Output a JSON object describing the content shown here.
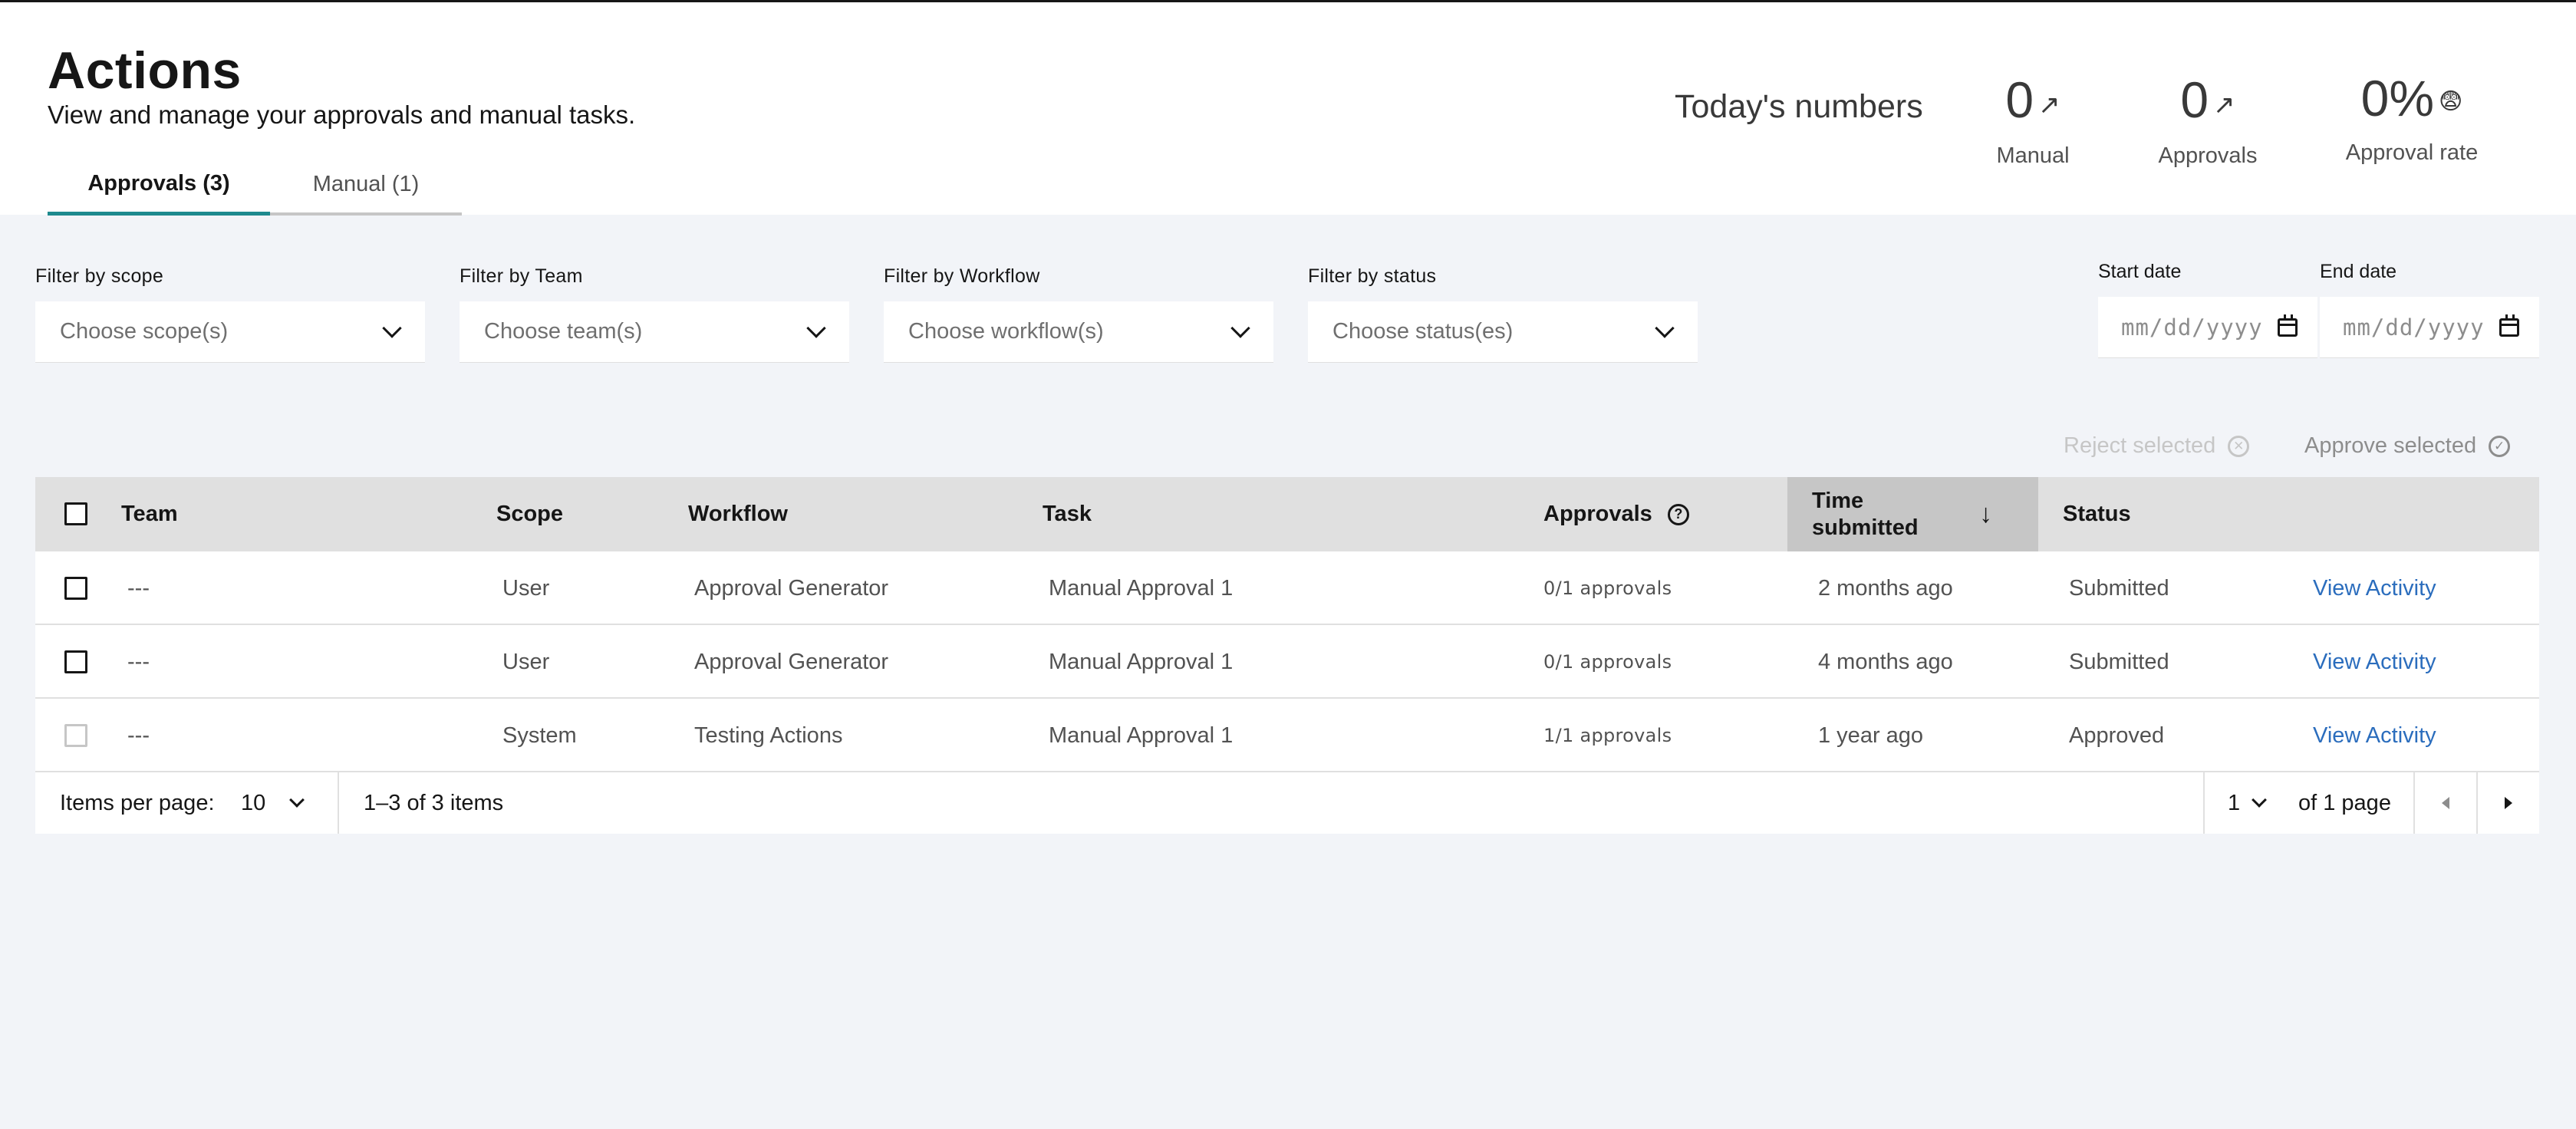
{
  "page": {
    "title": "Actions",
    "subtitle": "View and manage your approvals and manual tasks."
  },
  "tabs": [
    {
      "label": "Approvals (3)",
      "active": true
    },
    {
      "label": "Manual (1)",
      "active": false
    }
  ],
  "stats": {
    "label": "Today's numbers",
    "manual": {
      "value": "0",
      "arrow": "↗",
      "label": "Manual"
    },
    "approvals": {
      "value": "0",
      "arrow": "↗",
      "label": "Approvals"
    },
    "approval_rate": {
      "value": "0%",
      "emoji": "😨",
      "label": "Approval rate"
    }
  },
  "filters": {
    "scope": {
      "label": "Filter by scope",
      "placeholder": "Choose scope(s)"
    },
    "team": {
      "label": "Filter by Team",
      "placeholder": "Choose team(s)"
    },
    "workflow": {
      "label": "Filter by Workflow",
      "placeholder": "Choose workflow(s)"
    },
    "status": {
      "label": "Filter by status",
      "placeholder": "Choose status(es)"
    },
    "start_date": {
      "label": "Start date",
      "placeholder": "mm/dd/yyyy"
    },
    "end_date": {
      "label": "End date",
      "placeholder": "mm/dd/yyyy"
    }
  },
  "bulk_actions": {
    "reject": "Reject selected",
    "approve": "Approve selected"
  },
  "table": {
    "headers": {
      "team": "Team",
      "scope": "Scope",
      "workflow": "Workflow",
      "task": "Task",
      "approvals": "Approvals",
      "time_submitted_1": "Time",
      "time_submitted_2": "submitted",
      "status": "Status"
    },
    "rows": [
      {
        "team": "---",
        "scope": "User",
        "workflow": "Approval Generator",
        "task": "Manual Approval 1",
        "approvals": "0/1 approvals",
        "time": "2 months ago",
        "status": "Submitted",
        "action": "View Activity",
        "selectable": true
      },
      {
        "team": "---",
        "scope": "User",
        "workflow": "Approval Generator",
        "task": "Manual Approval 1",
        "approvals": "0/1 approvals",
        "time": "4 months ago",
        "status": "Submitted",
        "action": "View Activity",
        "selectable": true
      },
      {
        "team": "---",
        "scope": "System",
        "workflow": "Testing Actions",
        "task": "Manual Approval 1",
        "approvals": "1/1 approvals",
        "time": "1 year ago",
        "status": "Approved",
        "action": "View Activity",
        "selectable": false
      }
    ]
  },
  "pagination": {
    "items_per_page_label": "Items per page:",
    "items_per_page": "10",
    "range": "1–3 of 3 items",
    "page": "1",
    "of_pages": "of 1 page"
  },
  "colors": {
    "tab_active_border": "#1e8a8e",
    "link": "#2b6dbd",
    "background": "#f2f4f8"
  }
}
